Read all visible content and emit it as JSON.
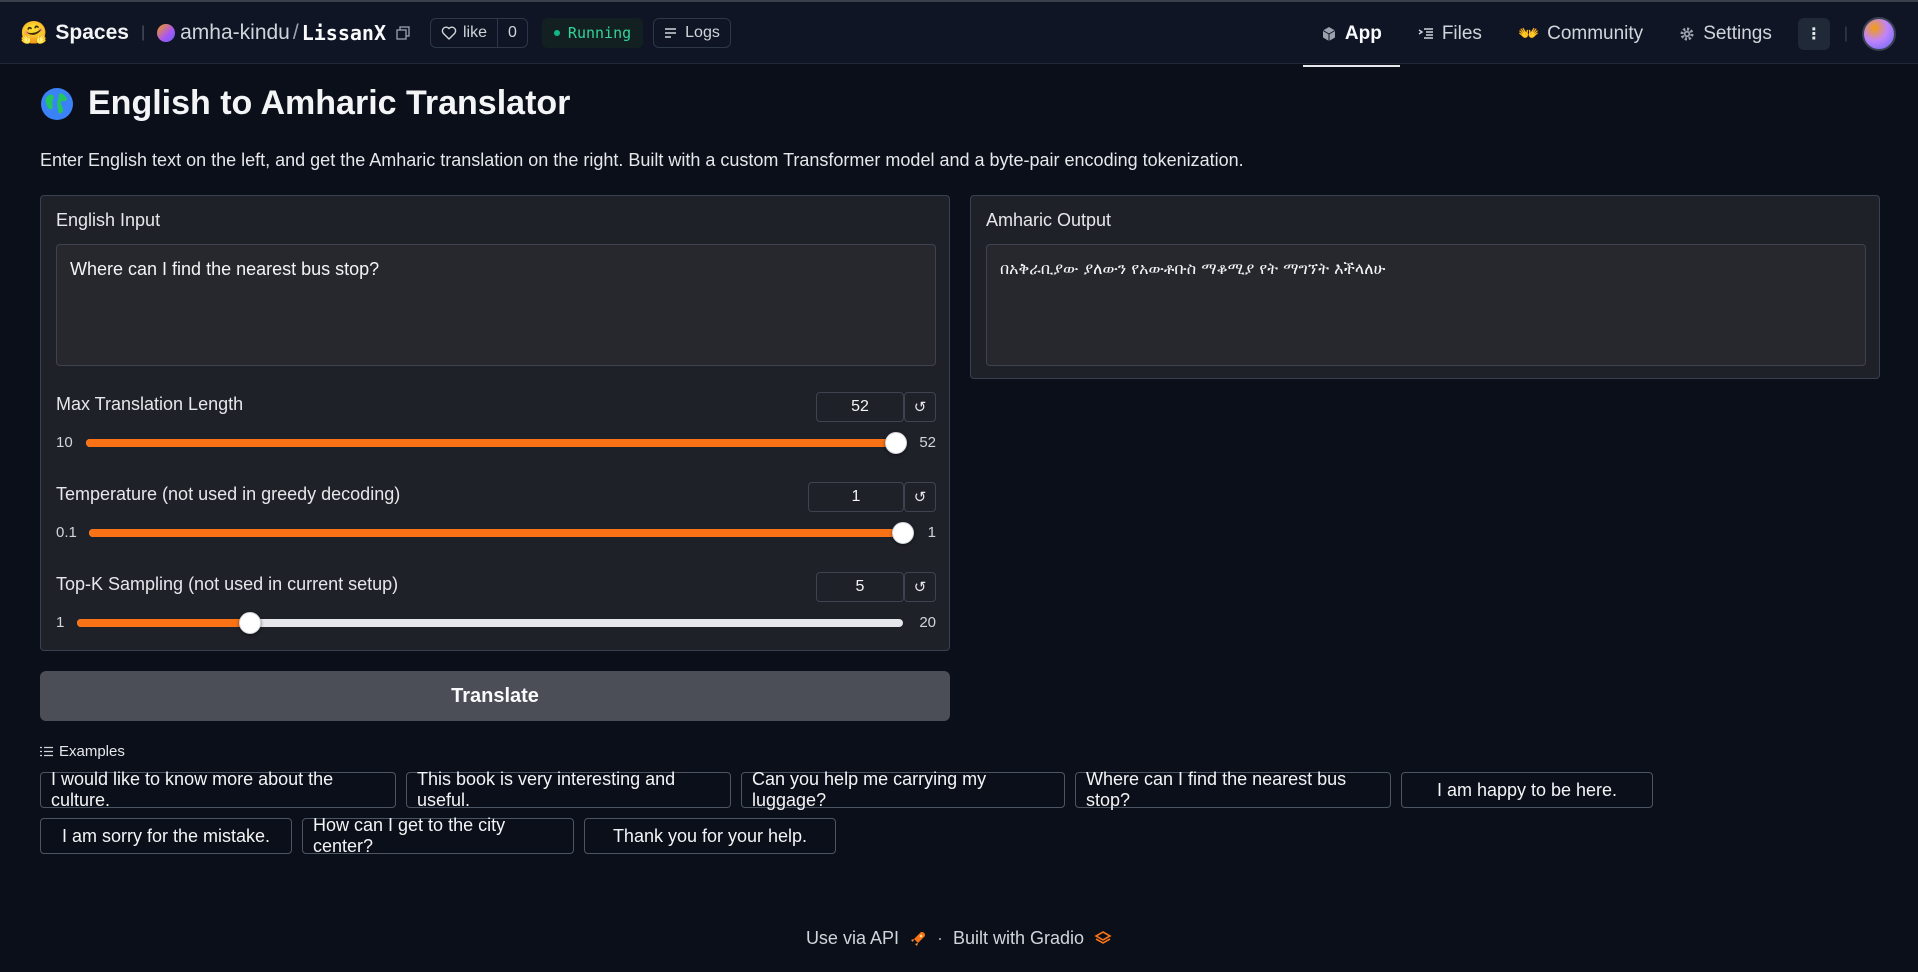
{
  "topbar": {
    "brand": "Spaces",
    "owner": "amha-kindu",
    "repo": "LissanX",
    "like_label": "like",
    "like_count": "0",
    "status": "Running",
    "logs_label": "Logs",
    "tabs": [
      {
        "label": "App",
        "icon": "cube-icon",
        "active": true
      },
      {
        "label": "Files",
        "icon": "files-icon",
        "active": false
      },
      {
        "label": "Community",
        "icon": "community-icon",
        "active": false
      },
      {
        "label": "Settings",
        "icon": "gear-icon",
        "active": false
      }
    ],
    "more_label": "⋮"
  },
  "page": {
    "title": "English to Amharic Translator",
    "description": "Enter English text on the left, and get the Amharic translation on the right. Built with a custom Transformer model and a byte-pair encoding tokenization."
  },
  "input": {
    "label": "English Input",
    "value": "Where can I find the nearest bus stop?"
  },
  "output": {
    "label": "Amharic Output",
    "value": "በአቅራቢያው ያለውን የአውቶቡስ ማቆሚያ የት ማግኘት እችላለሁ"
  },
  "sliders": [
    {
      "label": "Max Translation Length",
      "value": "52",
      "min": "10",
      "max": "52",
      "fraction": 1.0
    },
    {
      "label": "Temperature (not used in greedy decoding)",
      "value": "1",
      "min": "0.1",
      "max": "1",
      "fraction": 1.0
    },
    {
      "label": "Top-K Sampling (not used in current setup)",
      "value": "5",
      "min": "1",
      "max": "20",
      "fraction": 0.21
    }
  ],
  "reset_glyph": "↺",
  "translate_label": "Translate",
  "examples": {
    "header": "Examples",
    "items": [
      "I would like to know more about the culture.",
      "This book is very interesting and useful.",
      "Can you help me carrying my luggage?",
      "Where can I find the nearest bus stop?",
      "I am happy to be here.",
      "I am sorry for the mistake.",
      "How can I get to the city center?",
      "Thank you for your help."
    ]
  },
  "footer": {
    "api_label": "Use via API",
    "separator": "·",
    "built_label": "Built with Gradio"
  },
  "colors": {
    "accent": "#f97316",
    "status": "#34d399",
    "background": "#0b0f19"
  }
}
